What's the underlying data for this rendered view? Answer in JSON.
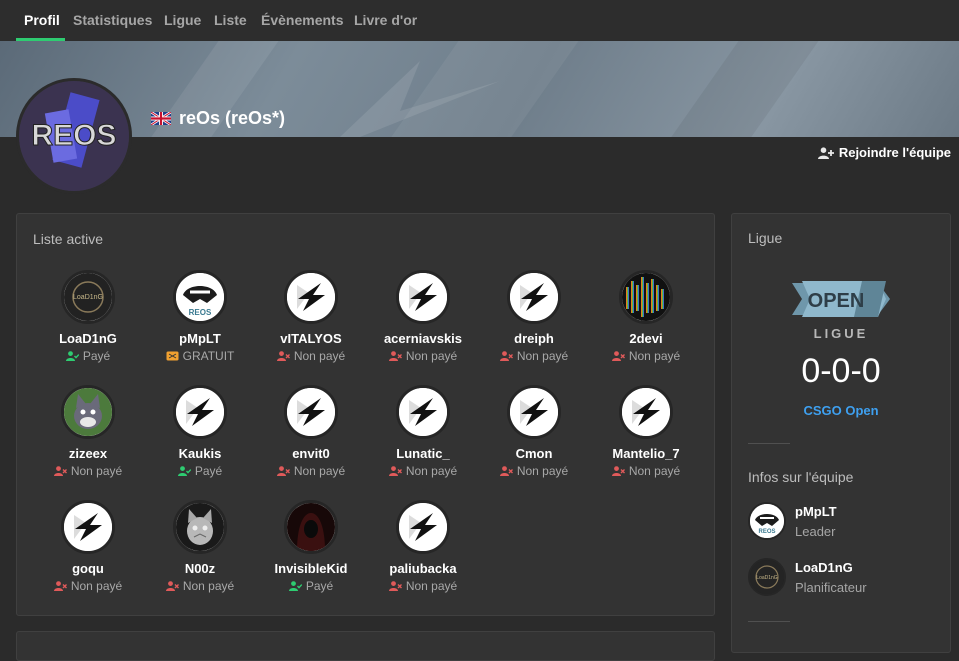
{
  "nav": {
    "tabs": [
      {
        "label": "Profil",
        "active": true
      },
      {
        "label": "Statistiques"
      },
      {
        "label": "Ligue"
      },
      {
        "label": "Liste"
      },
      {
        "label": "Évènements"
      },
      {
        "label": "Livre d'or"
      }
    ]
  },
  "team": {
    "name": "reOs (reOs*)",
    "flag_icon": "uk-flag-icon",
    "join_label": "Rejoindre l'équipe"
  },
  "roster": {
    "title": "Liste active",
    "players": [
      {
        "name": "LoaD1nG",
        "status": "Payé",
        "status_type": "paid",
        "avatar": "loading-logo"
      },
      {
        "name": "pMpLT",
        "status": "GRATUIT",
        "status_type": "free",
        "avatar": "reos-badger"
      },
      {
        "name": "vITALYOS",
        "status": "Non payé",
        "status_type": "unpaid",
        "avatar": "default-star"
      },
      {
        "name": "acerniavskis",
        "status": "Non payé",
        "status_type": "unpaid",
        "avatar": "default-star"
      },
      {
        "name": "dreiph",
        "status": "Non payé",
        "status_type": "unpaid",
        "avatar": "default-star"
      },
      {
        "name": "2devi",
        "status": "Non payé",
        "status_type": "unpaid",
        "avatar": "spectrum"
      },
      {
        "name": "zizeex",
        "status": "Non payé",
        "status_type": "unpaid",
        "avatar": "cartoon-cat"
      },
      {
        "name": "Kaukis",
        "status": "Payé",
        "status_type": "paid",
        "avatar": "default-star"
      },
      {
        "name": "envit0",
        "status": "Non payé",
        "status_type": "unpaid",
        "avatar": "default-star"
      },
      {
        "name": "Lunatic_",
        "status": "Non payé",
        "status_type": "unpaid",
        "avatar": "default-star"
      },
      {
        "name": "Cmon",
        "status": "Non payé",
        "status_type": "unpaid",
        "avatar": "default-star"
      },
      {
        "name": "Mantelio_7",
        "status": "Non payé",
        "status_type": "unpaid",
        "avatar": "default-star"
      },
      {
        "name": "goqu",
        "status": "Non payé",
        "status_type": "unpaid",
        "avatar": "default-star"
      },
      {
        "name": "N00z",
        "status": "Non payé",
        "status_type": "unpaid",
        "avatar": "grey-cat"
      },
      {
        "name": "InvisibleKid",
        "status": "Payé",
        "status_type": "paid",
        "avatar": "hooded-figure"
      },
      {
        "name": "paliubacka",
        "status": "Non payé",
        "status_type": "unpaid",
        "avatar": "default-star"
      }
    ]
  },
  "league": {
    "title": "Ligue",
    "logo_text": "OPEN",
    "label": "LIGUE",
    "record": "0-0-0",
    "link": "CSGO Open"
  },
  "team_info": {
    "title": "Infos sur l'équipe",
    "members": [
      {
        "name": "pMpLT",
        "role": "Leader",
        "avatar": "reos-badger"
      },
      {
        "name": "LoaD1nG",
        "role": "Planificateur",
        "avatar": "loading-logo"
      }
    ]
  },
  "colors": {
    "accent": "#2ecc71",
    "paid": "#2ecc71",
    "unpaid": "#e05a5a",
    "free": "#f0a030",
    "link": "#3ea0f0"
  }
}
